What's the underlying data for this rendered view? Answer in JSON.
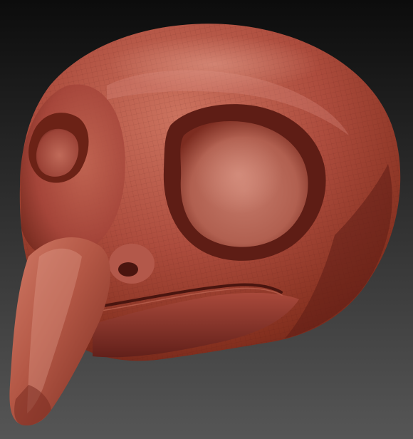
{
  "scene": {
    "subject": "bird-head-sculpt",
    "material": "red-wax-clay",
    "colors": {
      "background_top": "#0c0c0c",
      "background_bottom": "#565656",
      "clay_light": "#c86a56",
      "clay_mid": "#a8473a",
      "clay_dark": "#5e1d15",
      "clay_shadow": "#3f110c",
      "highlight": "#e3a08f"
    }
  }
}
